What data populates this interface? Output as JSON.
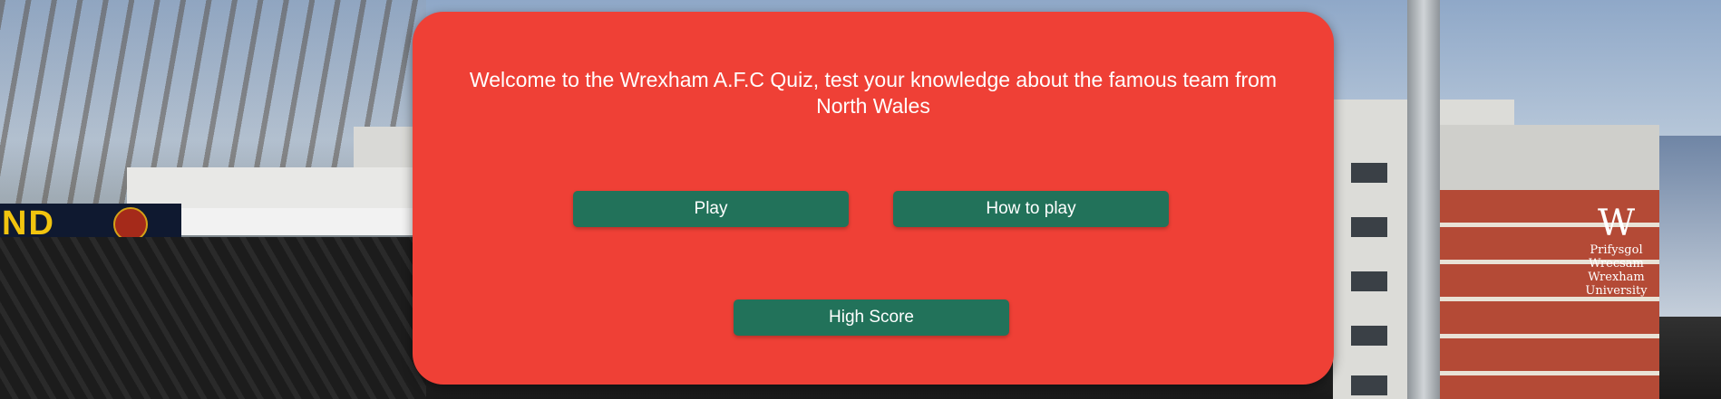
{
  "intro": {
    "welcome_text": "Welcome to the Wrexham A.F.C Quiz, test your knowledge about the famous team from North Wales"
  },
  "buttons": {
    "play_label": "Play",
    "how_to_play_label": "How to play",
    "high_score_label": "High Score"
  },
  "background": {
    "stand_banner_text": "ND",
    "building_sign_logo": "W",
    "building_sign_text": "Prifysgol Wrecsam Wrexham University"
  },
  "colors": {
    "card_background": "#ef4036",
    "button_background": "#22725a",
    "text": "#ffffff"
  }
}
